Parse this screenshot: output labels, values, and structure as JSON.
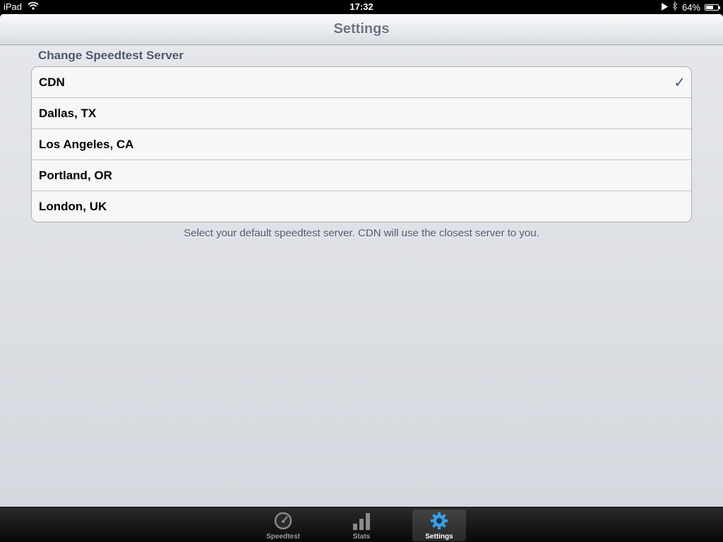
{
  "status_bar": {
    "device": "iPad",
    "time": "17:32",
    "battery": "64%",
    "battery_level": 0.64
  },
  "nav": {
    "title": "Settings"
  },
  "section": {
    "header": "Change Speedtest Server",
    "footer": "Select your default speedtest server. CDN will use the closest server to you."
  },
  "servers": [
    {
      "label": "CDN",
      "selected": true
    },
    {
      "label": "Dallas, TX",
      "selected": false
    },
    {
      "label": "Los Angeles, CA",
      "selected": false
    },
    {
      "label": "Portland, OR",
      "selected": false
    },
    {
      "label": "London, UK",
      "selected": false
    }
  ],
  "checkmark": "✓",
  "tabs": [
    {
      "label": "Speedtest",
      "icon": "speedometer-icon",
      "active": false
    },
    {
      "label": "Stats",
      "icon": "bar-chart-icon",
      "active": false
    },
    {
      "label": "Settings",
      "icon": "gear-icon",
      "active": true
    }
  ],
  "colors": {
    "accent_check": "#385487",
    "active_tab_icon": "#3a9ee8"
  }
}
